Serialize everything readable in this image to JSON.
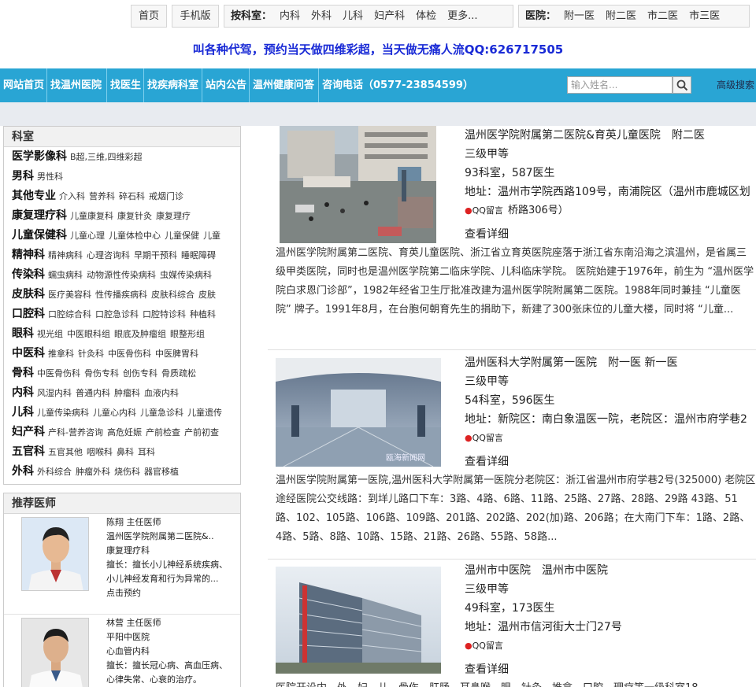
{
  "topbar": {
    "home": "首页",
    "mobile": "手机版",
    "dept_label": "按科室：",
    "depts": [
      "内科",
      "外科",
      "儿科",
      "妇产科",
      "体检",
      "更多..."
    ],
    "hosp_label": "医院：",
    "hosps": [
      "附一医",
      "附二医",
      "市二医",
      "市三医"
    ]
  },
  "slogan": "叫各种代驾，预约当天做四维彩超，当天做无痛人流QQ:626717505",
  "nav": {
    "items": [
      "网站首页",
      "找温州医院",
      "找医生",
      "找疾病科室",
      "站内公告",
      "温州健康问答",
      "咨询电话（0577-23854599）"
    ],
    "search_placeholder": "输入姓名...",
    "advanced": "高级搜索"
  },
  "departments": {
    "title": "科室",
    "rows": [
      {
        "name": "医学影像科",
        "subs": [
          "B超,三维,四维彩超"
        ]
      },
      {
        "name": "男科",
        "subs": [
          "男性科"
        ]
      },
      {
        "name": "其他专业",
        "subs": [
          "介入科",
          "营养科",
          "碎石科",
          "戒烟门诊"
        ]
      },
      {
        "name": "康复理疗科",
        "subs": [
          "儿童康复科",
          "康复针灸",
          "康复理疗"
        ]
      },
      {
        "name": "儿童保健科",
        "subs": [
          "儿童心理",
          "儿童体检中心",
          "儿童保健",
          "儿童"
        ]
      },
      {
        "name": "精神科",
        "subs": [
          "精神病科",
          "心理咨询科",
          "早期干预科",
          "睡眠障碍"
        ]
      },
      {
        "name": "传染科",
        "subs": [
          "蠕虫病科",
          "动物源性传染病科",
          "虫媒传染病科"
        ]
      },
      {
        "name": "皮肤科",
        "subs": [
          "医疗美容科",
          "性传播疾病科",
          "皮肤科综合",
          "皮肤"
        ]
      },
      {
        "name": "口腔科",
        "subs": [
          "口腔综合科",
          "口腔急诊科",
          "口腔特诊科",
          "种植科"
        ]
      },
      {
        "name": "眼科",
        "subs": [
          "视光组",
          "中医眼科组",
          "眼底及肿瘤组",
          "眼整形组"
        ]
      },
      {
        "name": "中医科",
        "subs": [
          "推拿科",
          "针灸科",
          "中医骨伤科",
          "中医脾胃科"
        ]
      },
      {
        "name": "骨科",
        "subs": [
          "中医骨伤科",
          "骨伤专科",
          "创伤专科",
          "骨质疏松"
        ]
      },
      {
        "name": "内科",
        "subs": [
          "风湿内科",
          "普通内科",
          "肿瘤科",
          "血液内科"
        ]
      },
      {
        "name": "儿科",
        "subs": [
          "儿童传染病科",
          "儿童心内科",
          "儿童急诊科",
          "儿童遗传"
        ]
      },
      {
        "name": "妇产科",
        "subs": [
          "产科-营养咨询",
          "高危妊娠",
          "产前检查",
          "产前初查"
        ]
      },
      {
        "name": "五官科",
        "subs": [
          "五官其他",
          "咽喉科",
          "鼻科",
          "耳科"
        ]
      },
      {
        "name": "外科",
        "subs": [
          "外科综合",
          "肿瘤外科",
          "烧伤科",
          "器官移植"
        ]
      }
    ]
  },
  "doctors": {
    "title": "推荐医师",
    "items": [
      {
        "name_title": "陈翔 主任医师",
        "hospital": "温州医学院附属第二医院&..",
        "dept": "康复理疗科",
        "skill1": "擅长：擅长小儿神经系统疾病、",
        "skill2": "小儿神经发育和行为异常的...",
        "action": "点击预约"
      },
      {
        "name_title": "林营 主任医师",
        "hospital": "平阳中医院",
        "dept": "心血管内科",
        "skill1": "擅长：擅长冠心病、高血压病、",
        "skill2": "心律失常、心衰的治疗。",
        "action": ""
      }
    ]
  },
  "hospitals": [
    {
      "name": "温州医学院附属第二医院&育英儿童医院　附二医",
      "level": "三级甲等",
      "counts": "93科室，587医生",
      "address": "地址：温州市学院西路109号，南浦院区（温州市鹿城区划",
      "address2": "桥路306号）",
      "qq": "QQ留言",
      "detail": "查看详细",
      "desc": "温州医学院附属第二医院、育英儿童医院、浙江省立育英医院座落于浙江省东南沿海之滨温州，是省属三级甲类医院，同时也是温州医学院第二临床学院、儿科临床学院。 医院始建于1976年，前生为 “温州医学院白求恩门诊部”，1982年经省卫生厅批准改建为温州医学院附属第二医院。1988年同时兼挂 “儿童医院” 牌子。1991年8月，在台胞何朝育先生的捐助下，新建了300张床位的儿童大楼，同时将 “儿童..."
    },
    {
      "name": "温州医科大学附属第一医院　附一医 新一医",
      "level": "三级甲等",
      "counts": "54科室，596医生",
      "address": "地址：新院区：南白象温医一院，老院区：温州市府学巷2",
      "address2": "",
      "qq": "QQ留言",
      "detail": "查看详细",
      "watermark": "瓯海新闻网",
      "desc": "温州医学院附属第一医院,温州医科大学附属第一医院分老院区：浙江省温州市府学巷2号(325000) 老院区途经医院公交线路：到垟儿路口下车：3路、4路、6路、11路、25路、27路、28路、29路 43路、51路、102、105路、106路、109路、201路、202路、202(加)路、206路；在大南门下车：1路、2路、4路、5路、8路、10路、15路、21路、26路、55路、58路..."
    },
    {
      "name": "温州市中医院　温州市中医院",
      "level": "三级甲等",
      "counts": "49科室，173医生",
      "address": "地址：温州市信河街大士门27号",
      "address2": "",
      "qq": "QQ留言",
      "detail": "查看详细",
      "desc": "医院开设内、外、妇、儿、骨伤、肛肠、耳鼻喉、眼、针灸、推拿、口腔、理疗等一级科室18..."
    }
  ],
  "colors": {
    "nav_bg": "#29a5d4",
    "slogan": "#1a2bd6"
  }
}
